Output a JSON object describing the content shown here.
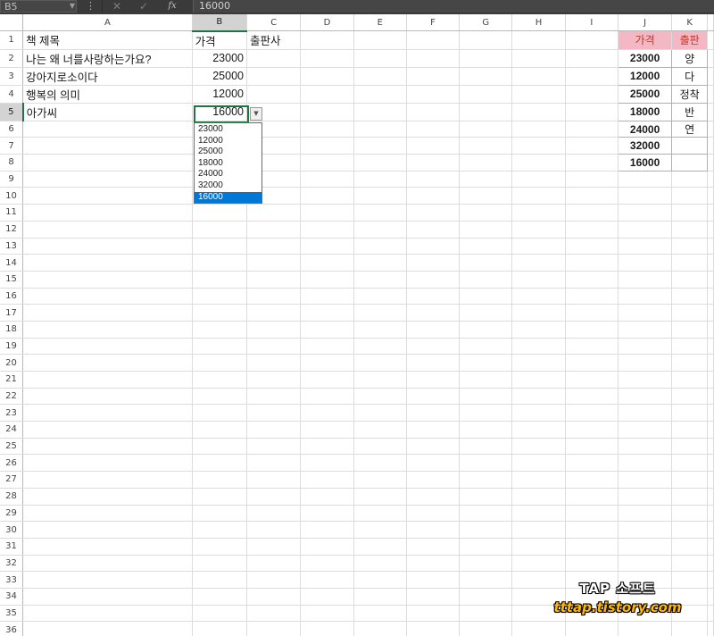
{
  "formula_bar": {
    "name_box": "B5",
    "options_icon": "⋮",
    "cancel_icon": "✕",
    "enter_icon": "✓",
    "fx_label": "fx",
    "formula_value": "16000"
  },
  "columns": [
    "A",
    "B",
    "C",
    "D",
    "E",
    "F",
    "G",
    "H",
    "I",
    "J",
    "K"
  ],
  "rows": [
    "1",
    "2",
    "3",
    "4",
    "5",
    "6",
    "7",
    "8",
    "9",
    "10",
    "11",
    "12",
    "13",
    "14",
    "15",
    "16",
    "17",
    "18",
    "19",
    "20",
    "21",
    "22",
    "23",
    "24",
    "25",
    "26",
    "27",
    "28",
    "29",
    "30",
    "31",
    "32",
    "33",
    "34",
    "35",
    "36"
  ],
  "cells": {
    "A1": "책 제목",
    "B1": "가격",
    "C1": "출판사",
    "A2": "나는 왜 너를사랑하는가요?",
    "B2": "23000",
    "A3": "강아지로소이다",
    "B3": "25000",
    "A4": "행복의 의미",
    "B4": "12000",
    "A5": "아가씨",
    "B5": "16000",
    "J1": "가격",
    "K1": "출판",
    "J2": "23000",
    "K2": "양",
    "J3": "12000",
    "K3": "다",
    "J4": "25000",
    "K4": "정착",
    "J5": "18000",
    "K5": "반",
    "J6": "24000",
    "K6": "연",
    "J7": "32000",
    "J8": "16000"
  },
  "dropdown": {
    "options": [
      "23000",
      "12000",
      "25000",
      "18000",
      "24000",
      "32000",
      "16000"
    ],
    "selected_index": 6
  },
  "watermark": {
    "title": "TAP 소프트",
    "url": "tttap.tistory.com"
  },
  "colors": {
    "accent": "#217346",
    "list_highlight": "#0078d7",
    "header_pink": "#f4b8c4"
  }
}
